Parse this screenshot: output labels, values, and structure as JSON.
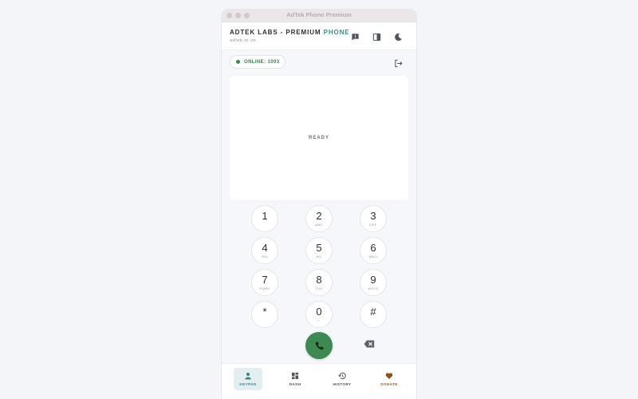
{
  "window": {
    "title": "AdTek Phone Premium"
  },
  "header": {
    "brand_main": "ADTEK LABS - PREMIUM ",
    "brand_accent": "PHONE",
    "domain": "adtek.io.vn",
    "icons": [
      "message-icon",
      "layout-icon",
      "dark-mode-icon"
    ]
  },
  "status": {
    "label": "ONLINE: 1003",
    "color": "#3a8a4f"
  },
  "display": {
    "state": "READY"
  },
  "keypad": {
    "keys": [
      {
        "digit": "1",
        "letters": ""
      },
      {
        "digit": "2",
        "letters": "ABC"
      },
      {
        "digit": "3",
        "letters": "DEF"
      },
      {
        "digit": "4",
        "letters": "GHI"
      },
      {
        "digit": "5",
        "letters": "JKL"
      },
      {
        "digit": "6",
        "letters": "MNO"
      },
      {
        "digit": "7",
        "letters": "PQRS"
      },
      {
        "digit": "8",
        "letters": "TUV"
      },
      {
        "digit": "9",
        "letters": "WXYZ"
      },
      {
        "digit": "*",
        "letters": ""
      },
      {
        "digit": "0",
        "letters": "+"
      },
      {
        "digit": "#",
        "letters": ""
      }
    ]
  },
  "actions": {
    "call_icon": "phone-icon",
    "backspace_icon": "backspace-icon",
    "call_color": "#3c8a52"
  },
  "nav": {
    "items": [
      {
        "label": "KEYPAD",
        "icon": "person-icon",
        "active": true
      },
      {
        "label": "DASH",
        "icon": "dashboard-icon",
        "active": false
      },
      {
        "label": "HISTORY",
        "icon": "history-icon",
        "active": false
      },
      {
        "label": "DONATE",
        "icon": "heart-icon",
        "active": false,
        "color": "#9a5a18"
      }
    ]
  }
}
